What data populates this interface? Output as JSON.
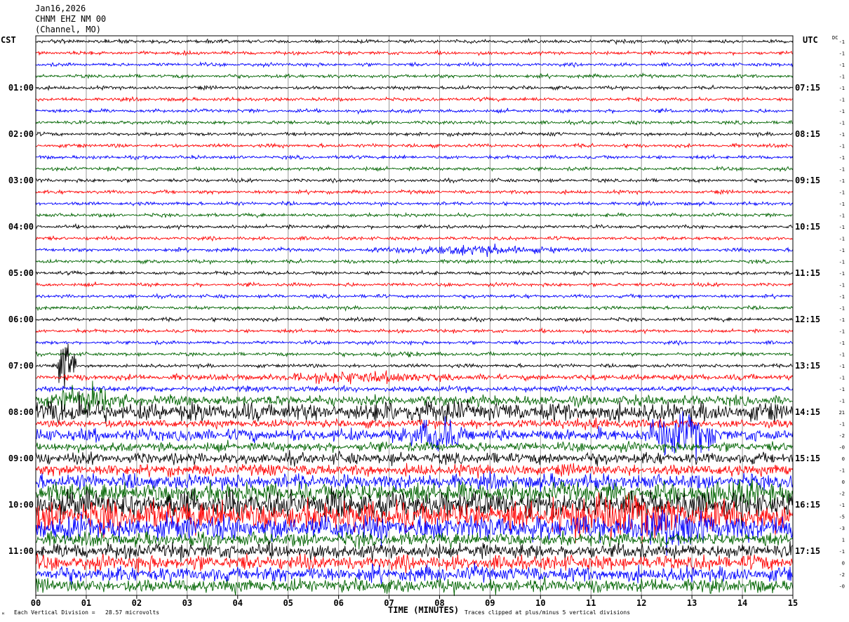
{
  "header": {
    "date": "Jan16,2026",
    "station": "CHNM EHZ NM 00",
    "network": "(Channel, MO)"
  },
  "left_timezone": "CST",
  "right_timezone": "UTC",
  "dc_label": "DC",
  "footer": {
    "scale_note": "Each Vertical Division =   28.57 microvolts",
    "clip_note": "Traces clipped at plus/minus 5 vertical divisions",
    "corner_mark": "ᴹ"
  },
  "chart_data": {
    "type": "line",
    "subtype": "helicorder",
    "title": "",
    "xlabel": "TIME (MINUTES)",
    "x_ticks": [
      "00",
      "01",
      "02",
      "03",
      "04",
      "05",
      "06",
      "07",
      "08",
      "09",
      "10",
      "11",
      "12",
      "13",
      "14",
      "15"
    ],
    "xlim": [
      0,
      15
    ],
    "minutes_per_line": 15,
    "line_count": 48,
    "trace_colors": [
      "#000000",
      "#ff0000",
      "#0000ff",
      "#006400"
    ],
    "left_time_labels": [
      {
        "line": 4,
        "label": "01:00"
      },
      {
        "line": 8,
        "label": "02:00"
      },
      {
        "line": 12,
        "label": "03:00"
      },
      {
        "line": 16,
        "label": "04:00"
      },
      {
        "line": 20,
        "label": "05:00"
      },
      {
        "line": 24,
        "label": "06:00"
      },
      {
        "line": 28,
        "label": "07:00"
      },
      {
        "line": 32,
        "label": "08:00"
      },
      {
        "line": 36,
        "label": "09:00"
      },
      {
        "line": 40,
        "label": "10:00"
      },
      {
        "line": 44,
        "label": "11:00"
      }
    ],
    "right_time_labels": [
      {
        "line": 4,
        "label": "07:15"
      },
      {
        "line": 8,
        "label": "08:15"
      },
      {
        "line": 12,
        "label": "09:15"
      },
      {
        "line": 16,
        "label": "10:15"
      },
      {
        "line": 20,
        "label": "11:15"
      },
      {
        "line": 24,
        "label": "12:15"
      },
      {
        "line": 28,
        "label": "13:15"
      },
      {
        "line": 32,
        "label": "14:15"
      },
      {
        "line": 36,
        "label": "15:15"
      },
      {
        "line": 40,
        "label": "16:15"
      },
      {
        "line": 44,
        "label": "17:15"
      }
    ],
    "dc_offsets": [
      "-1",
      "-1",
      "-1",
      "-1",
      "-1",
      "-1",
      "-1",
      "-1",
      "-1",
      "-1",
      "-1",
      "-1",
      "-1",
      "-1",
      "-1",
      "-1",
      "-1",
      "-1",
      "-1",
      "-1",
      "-1",
      "-1",
      "-1",
      "-1",
      "-1",
      "-1",
      "-1",
      "-1",
      "-1",
      "-1",
      "-1",
      "-1",
      "21",
      "-1",
      "-2",
      "-0",
      "0",
      "-1",
      "0",
      "-2",
      "-1",
      "-5",
      "-3",
      "1",
      "-1",
      "0",
      "-2",
      "-0"
    ],
    "line_amplitude_divisions": [
      0.3,
      0.3,
      0.3,
      0.3,
      0.3,
      0.3,
      0.3,
      0.3,
      0.3,
      0.3,
      0.3,
      0.3,
      0.3,
      0.3,
      0.3,
      0.3,
      0.3,
      0.3,
      0.3,
      0.3,
      0.3,
      0.3,
      0.3,
      0.3,
      0.3,
      0.3,
      0.3,
      0.3,
      0.3,
      0.5,
      0.5,
      0.9,
      1.6,
      0.7,
      1.1,
      0.8,
      1.0,
      1.0,
      1.3,
      1.8,
      2.4,
      2.6,
      2.2,
      1.2,
      1.3,
      1.3,
      1.3,
      1.2
    ],
    "events": [
      {
        "line": 18,
        "start_min": 6.6,
        "end_min": 10.6,
        "amp_divisions": 1.0
      },
      {
        "line": 27,
        "start_min": 6.3,
        "end_min": 8.0,
        "amp_divisions": 0.6
      },
      {
        "line": 28,
        "start_min": 0.4,
        "end_min": 0.8,
        "amp_divisions": 5.0
      },
      {
        "line": 29,
        "start_min": 4.5,
        "end_min": 8.5,
        "amp_divisions": 1.2
      },
      {
        "line": 31,
        "start_min": 0.0,
        "end_min": 1.8,
        "amp_divisions": 3.0
      },
      {
        "line": 32,
        "start_min": 0.0,
        "end_min": 1.6,
        "amp_divisions": 3.0
      },
      {
        "line": 32,
        "start_min": 5.5,
        "end_min": 9.5,
        "amp_divisions": 2.0
      },
      {
        "line": 33,
        "start_min": 9.0,
        "end_min": 13.5,
        "amp_divisions": 1.0
      },
      {
        "line": 34,
        "start_min": 7.3,
        "end_min": 8.6,
        "amp_divisions": 3.5
      },
      {
        "line": 34,
        "start_min": 12.0,
        "end_min": 13.5,
        "amp_divisions": 5.0
      },
      {
        "line": 39,
        "start_min": 12.5,
        "end_min": 15.0,
        "amp_divisions": 3.0
      },
      {
        "line": 40,
        "start_min": 0.0,
        "end_min": 15.0,
        "amp_divisions": 2.0
      },
      {
        "line": 41,
        "start_min": 10.0,
        "end_min": 13.0,
        "amp_divisions": 5.0
      },
      {
        "line": 42,
        "start_min": 11.5,
        "end_min": 13.5,
        "amp_divisions": 5.0
      }
    ]
  }
}
